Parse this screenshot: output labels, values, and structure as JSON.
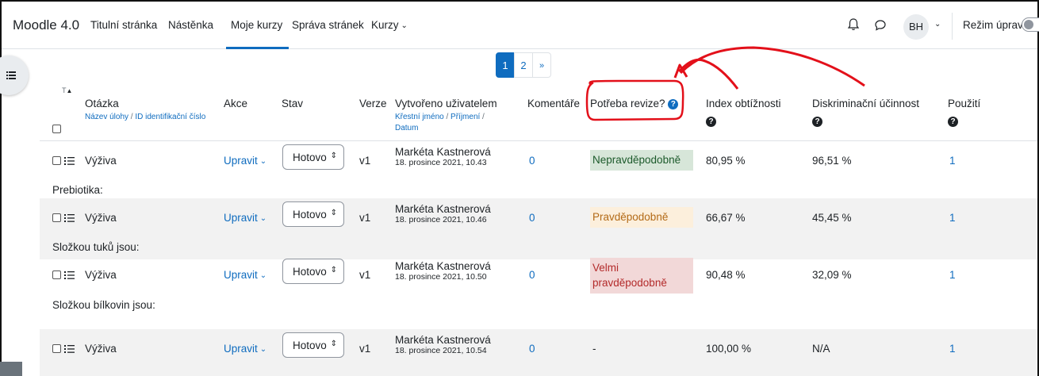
{
  "navbar": {
    "brand": "Moodle 4.0",
    "links": [
      {
        "label": "Titulní stránka"
      },
      {
        "label": "Nástěnka"
      },
      {
        "label": "Moje kurzy"
      },
      {
        "label": "Správa stránek"
      },
      {
        "label": "Kurzy"
      }
    ],
    "avatar_initials": "BH",
    "edit_mode_label": "Režim úprav"
  },
  "pagination": {
    "pages": [
      "1",
      "2"
    ],
    "next_label": "»",
    "current_page": 1
  },
  "table": {
    "headers": {
      "question": "Otázka",
      "question_sort_indicator": "T",
      "question_sub_name": "Název úlohy",
      "question_sub_sep": " / ",
      "question_sub_id": "ID identifikační číslo",
      "actions": "Akce",
      "status": "Stav",
      "version": "Verze",
      "created_by": "Vytvořeno uživatelem",
      "created_sub_first": "Křestní jméno",
      "created_sub_sep1": " / ",
      "created_sub_last": "Příjmení",
      "created_sub_sep2": " /",
      "created_sub_date": "Datum",
      "comments": "Komentáře",
      "needs_review": "Potřeba revize?",
      "difficulty": "Index obtížnosti",
      "discrimination": "Diskriminační účinnost",
      "usage": "Použití",
      "help_glyph": "?"
    },
    "rows": [
      {
        "name": "Výživa",
        "action": "Upravit",
        "status": "Hotovo",
        "version": "v1",
        "author": "Markéta Kastnerová",
        "date": "18. prosince 2021, 10.43",
        "comments": "0",
        "review": "Nepravděpodobně",
        "difficulty": "80,95 %",
        "discrimination": "96,51 %",
        "usage": "1",
        "question_text": "Prebiotika:"
      },
      {
        "name": "Výživa",
        "action": "Upravit",
        "status": "Hotovo",
        "version": "v1",
        "author": "Markéta Kastnerová",
        "date": "18. prosince 2021, 10.46",
        "comments": "0",
        "review": "Pravděpodobně",
        "difficulty": "66,67 %",
        "discrimination": "45,45 %",
        "usage": "1",
        "question_text": "Složkou tuků jsou:"
      },
      {
        "name": "Výživa",
        "action": "Upravit",
        "status": "Hotovo",
        "version": "v1",
        "author": "Markéta Kastnerová",
        "date": "18. prosince 2021, 10.50",
        "comments": "0",
        "review": "Velmi pravděpodobně",
        "difficulty": "90,48 %",
        "discrimination": "32,09 %",
        "usage": "1",
        "question_text": "Složkou bílkovin jsou:"
      },
      {
        "name": "Výživa",
        "action": "Upravit",
        "status": "Hotovo",
        "version": "v1",
        "author": "Markéta Kastnerová",
        "date": "18. prosince 2021, 10.54",
        "comments": "0",
        "review": "-",
        "difficulty": "100,00 %",
        "discrimination": "N/A",
        "usage": "1"
      }
    ]
  },
  "colors": {
    "accent": "#0f6cbf",
    "annotation": "#e3101a",
    "badge_unlikely": "#d7e6d9",
    "badge_likely": "#fcefdc",
    "badge_very_likely": "#f2d8d8"
  }
}
